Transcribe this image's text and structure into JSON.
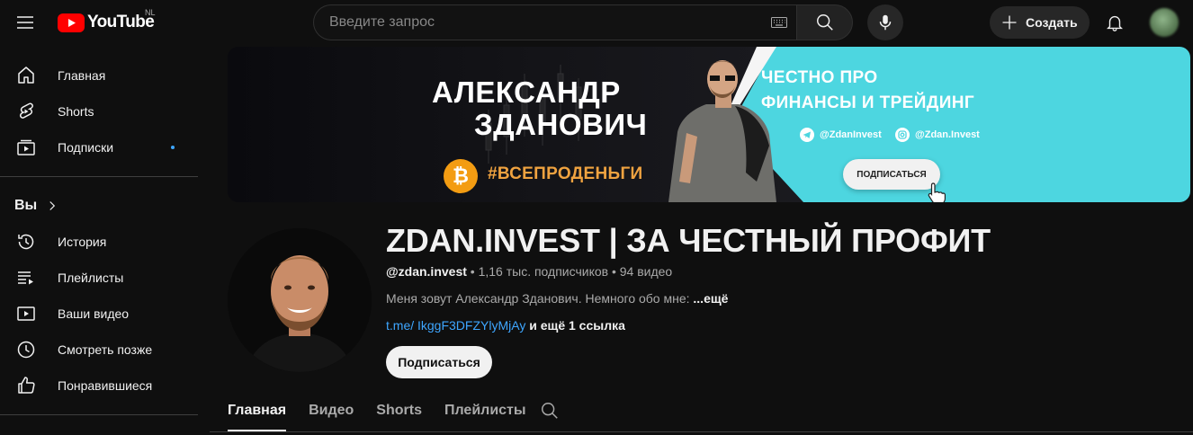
{
  "topbar": {
    "logo_text": "YouTube",
    "region": "NL",
    "search_placeholder": "Введите запрос",
    "create_label": "Создать"
  },
  "sidebar": {
    "main": [
      {
        "label": "Главная",
        "icon": "home-icon"
      },
      {
        "label": "Shorts",
        "icon": "shorts-icon"
      },
      {
        "label": "Подписки",
        "icon": "subscriptions-icon"
      }
    ],
    "you_label": "Вы",
    "you_items": [
      {
        "label": "История",
        "icon": "history-icon"
      },
      {
        "label": "Плейлисты",
        "icon": "playlists-icon"
      },
      {
        "label": "Ваши видео",
        "icon": "your-videos-icon"
      },
      {
        "label": "Смотреть позже",
        "icon": "watch-later-icon"
      },
      {
        "label": "Понравившиеся",
        "icon": "liked-icon"
      }
    ]
  },
  "banner": {
    "name_line1": "АЛЕКСАНДР",
    "name_line2": "ЗДАНОВИЧ",
    "hashtag": "#ВСЕПРОДЕНЬГИ",
    "headline_line1": "ЧЕСТНО ПРО",
    "headline_line2": "ФИНАНСЫ И ТРЕЙДИНГ",
    "telegram": "@ZdanInvest",
    "instagram": "@Zdan.Invest",
    "subscribe": "ПОДПИСАТЬСЯ"
  },
  "channel": {
    "title": "ZDAN.INVEST | ЗА ЧЕСТНЫЙ ПРОФИТ",
    "handle": "@zdan.invest",
    "meta": " • 1,16 тыс. подписчиков • 94 видео",
    "description": "Меня зовут Александр Зданович. Немного обо мне: ",
    "more": "...ещё",
    "link": "t.me/ IkggF3DFZYlyMjAy",
    "link_extra": " и ещё 1 ссылка",
    "subscribe": "Подписаться"
  },
  "tabs": [
    "Главная",
    "Видео",
    "Shorts",
    "Плейлисты"
  ],
  "colors": {
    "background": "#0f0f0f",
    "accent_red": "#ff0000",
    "link_blue": "#3ea6ff",
    "banner_teal": "#4dd6e0",
    "hashtag_orange": "#f0a340"
  }
}
